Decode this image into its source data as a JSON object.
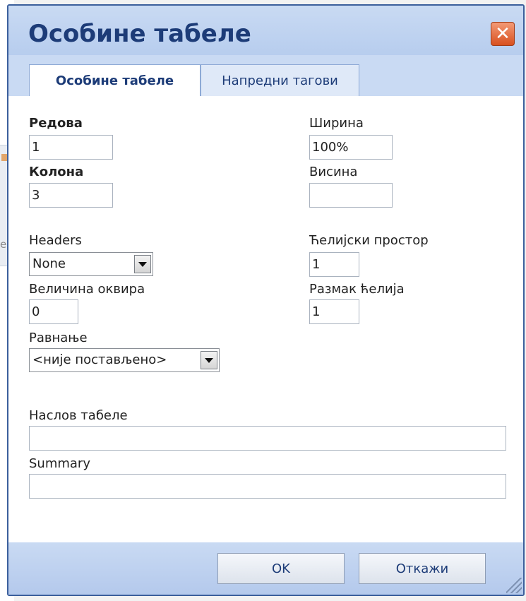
{
  "dialog": {
    "title": "Особине табеле",
    "close_icon": "close-icon"
  },
  "tabs": [
    {
      "label": "Особине табеле",
      "active": true
    },
    {
      "label": "Напредни тагови",
      "active": false
    }
  ],
  "form": {
    "rows": {
      "label": "Редова",
      "value": "1"
    },
    "columns": {
      "label": "Колона",
      "value": "3"
    },
    "width": {
      "label": "Ширина",
      "value": "100%"
    },
    "height": {
      "label": "Висина",
      "value": ""
    },
    "headers": {
      "label": "Headers",
      "value": "None"
    },
    "cell_spacing": {
      "label": "Ћелијски простор",
      "value": "1"
    },
    "border_size": {
      "label": "Величина оквира",
      "value": "0"
    },
    "cell_padding": {
      "label": "Размак ћелија",
      "value": "1"
    },
    "alignment": {
      "label": "Равнање",
      "value": "<није постављено>"
    },
    "caption": {
      "label": "Наслов табеле",
      "value": ""
    },
    "summary": {
      "label": "Summary",
      "value": ""
    }
  },
  "buttons": {
    "ok": "OK",
    "cancel": "Откажи"
  },
  "background": {
    "partial_text": "er"
  },
  "colors": {
    "title_bar": "#c9daf3",
    "title_text": "#1d3c78",
    "frame": "#4f7cc4",
    "close_button": "#d8501f"
  }
}
